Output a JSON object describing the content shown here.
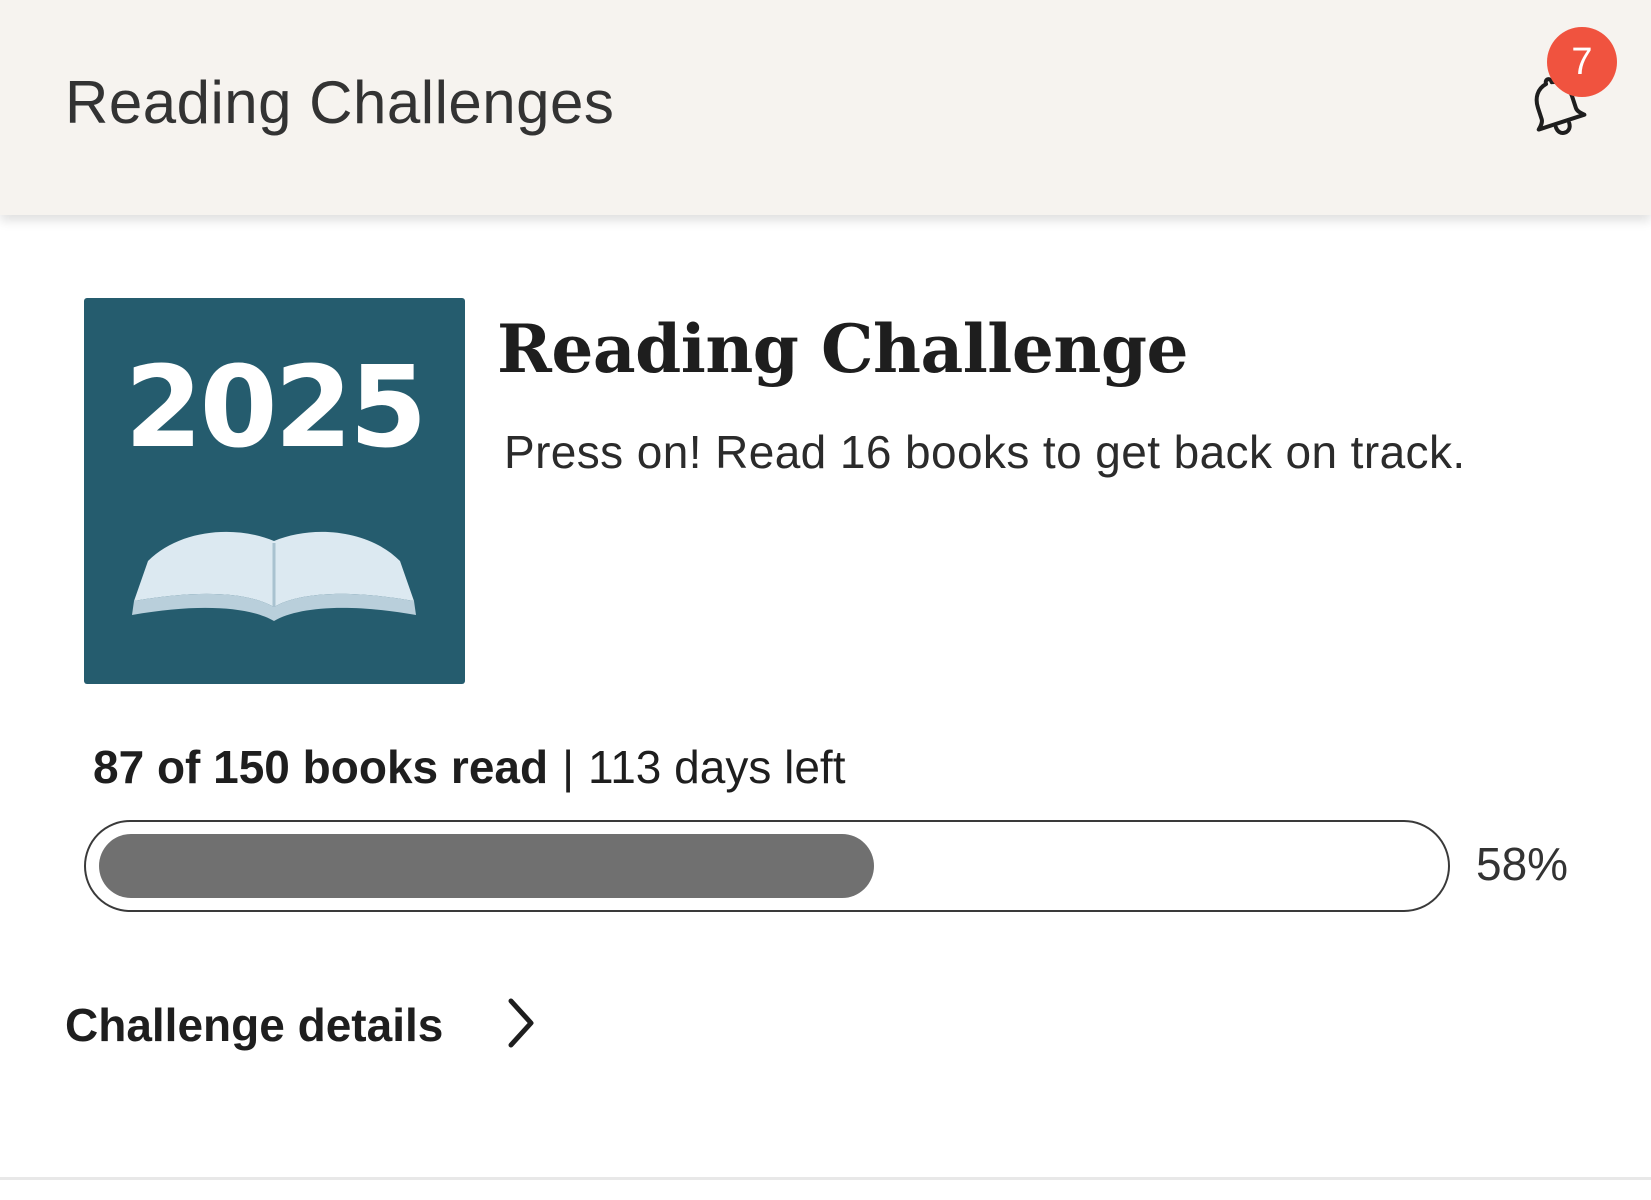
{
  "header": {
    "title": "Reading Challenges",
    "notifications": {
      "icon": "bell-icon",
      "badge_count": "7",
      "badge_color": "#f0533f"
    },
    "background": "#f6f3ef"
  },
  "challenge": {
    "cover": {
      "year": "2025",
      "icon": "open-book-icon",
      "background": "#255c6e"
    },
    "title": "Reading Challenge",
    "message": "Press on! Read 16 books to get back on track.",
    "progress": {
      "count_text": "87 of 150 books read",
      "separator": "|",
      "days_left_text": "113 days left",
      "percent_label": "58%",
      "fraction": 0.58,
      "fill_color": "#707070"
    },
    "details_link": {
      "label": "Challenge details",
      "icon": "chevron-right-icon"
    }
  }
}
